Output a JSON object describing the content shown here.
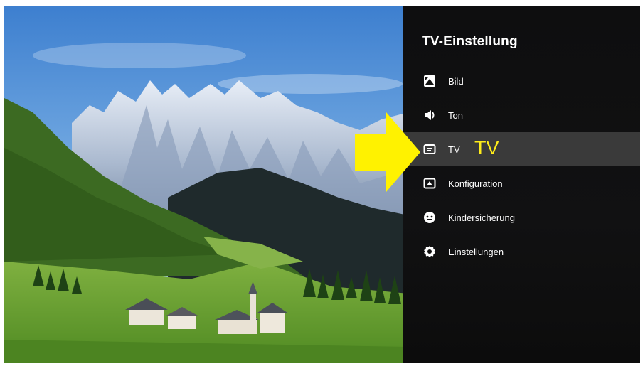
{
  "panel": {
    "title": "TV-Einstellung",
    "items": [
      {
        "label": "Bild",
        "icon": "picture-icon"
      },
      {
        "label": "Ton",
        "icon": "speaker-icon"
      },
      {
        "label": "TV",
        "icon": "tv-icon",
        "active": true
      },
      {
        "label": "Konfiguration",
        "icon": "configuration-icon"
      },
      {
        "label": "Kindersicherung",
        "icon": "child-lock-icon"
      },
      {
        "label": "Einstellungen",
        "icon": "gear-icon"
      }
    ]
  },
  "annotation": {
    "label": "TV",
    "color": "#ffec1a"
  },
  "colors": {
    "highlight": "#3a3a3a",
    "arrow": "#fff200"
  }
}
